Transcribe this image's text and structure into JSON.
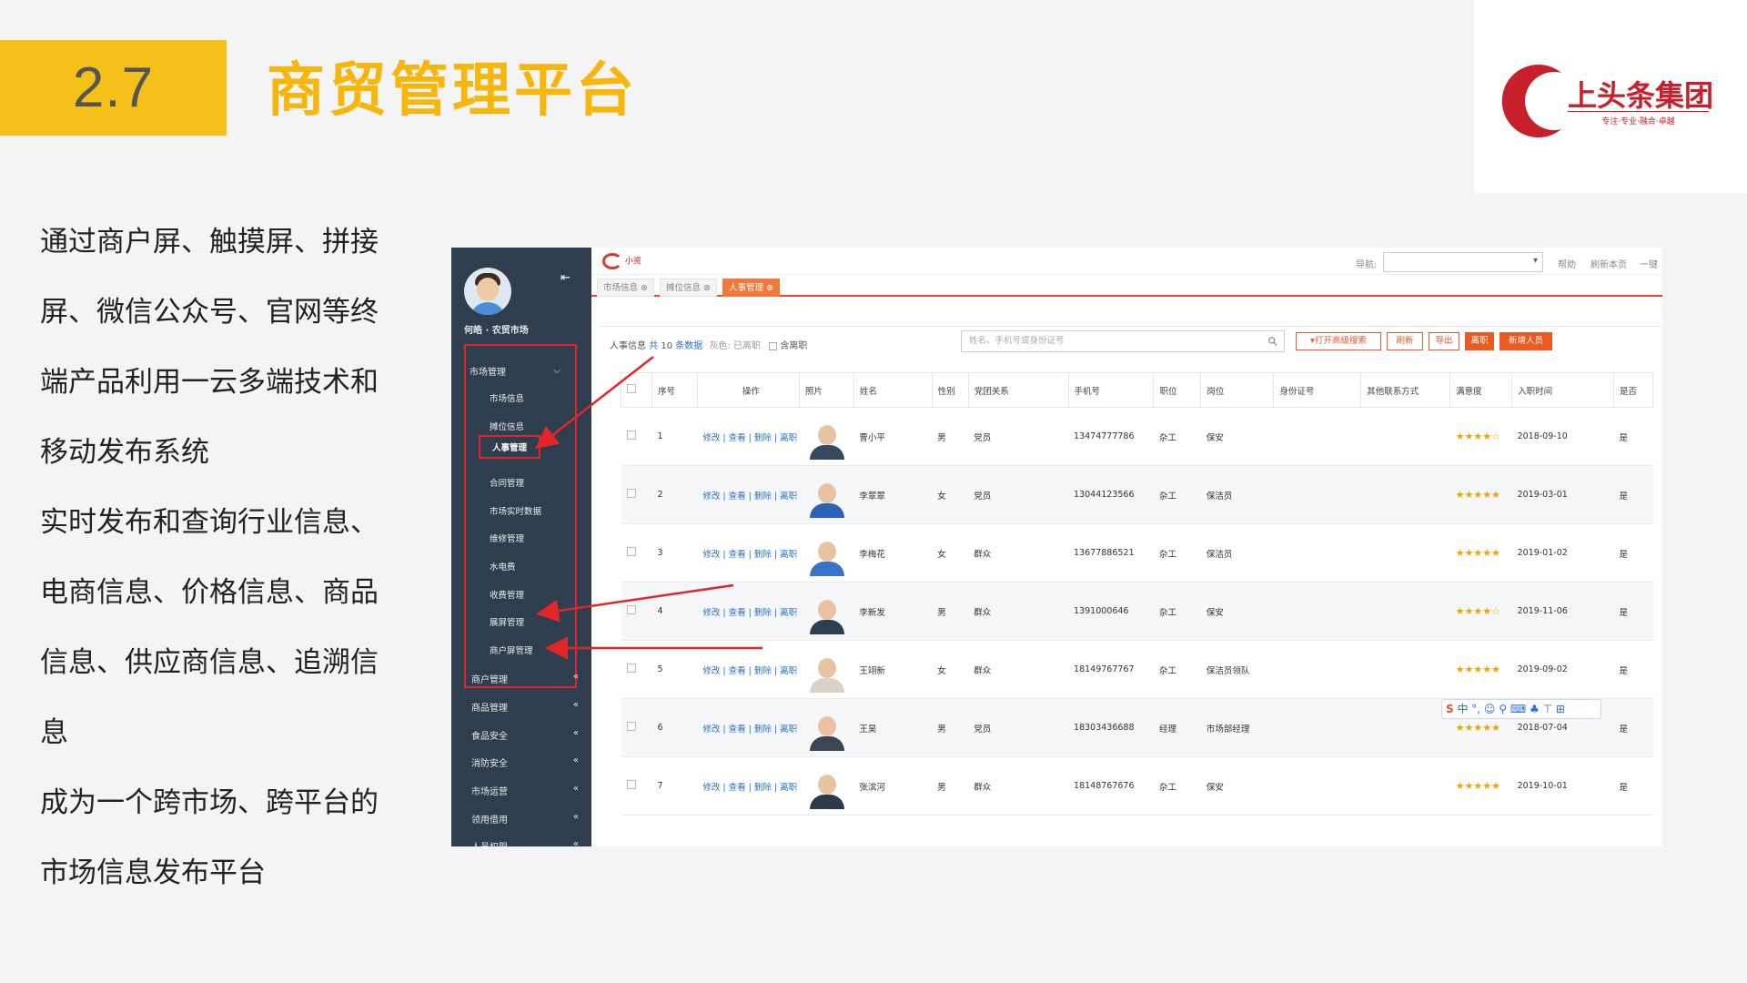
{
  "slide": {
    "number": "2.7",
    "title": "商贸管理平台",
    "logo_text": "上头条集团",
    "logo_slogan": "专注·专业·融合·卓越",
    "desc": [
      "通过商户屏、触摸屏、拼接",
      "屏、微信公众号、官网等终",
      "端产品利用一云多端技术和",
      "移动发布系统",
      "实时发布和查询行业信息、",
      "电商信息、价格信息、商品",
      "信息、供应商信息、追溯信",
      "息",
      "成为一个跨市场、跨平台的",
      "市场信息发布平台"
    ]
  },
  "colors": {
    "accent": "#f5c018",
    "title": "#f6b60c",
    "sidebar": "#2f3e4e",
    "highlight": "#e0262a",
    "orange": "#ee5a1e",
    "link": "#2b70c8",
    "star": "#f2a200"
  },
  "app": {
    "brand": "小资",
    "user_name": "何皓 · 农贸市场",
    "collapse_icon": "⇤",
    "menu_group": "市场管理",
    "submenu": [
      "市场信息",
      "摊位信息",
      "人事管理",
      "合同管理",
      "市场实时数据",
      "维修管理",
      "水电费",
      "收费管理",
      "展屏管理",
      "商户屏管理"
    ],
    "sections": [
      "商户管理",
      "商品管理",
      "食品安全",
      "消防安全",
      "市场运营",
      "领用借用",
      "人员权限"
    ],
    "nav_label": "导航:",
    "top_links": [
      "帮助",
      "刷新本页",
      "一键"
    ],
    "tabs": [
      {
        "label": "市场信息 ⊗"
      },
      {
        "label": "摊位信息 ⊗"
      },
      {
        "label": "人事管理 ⊗"
      }
    ],
    "toolbar": {
      "section": "人事信息",
      "count_prefix": "共",
      "count": "10",
      "count_suffix": "条数据",
      "legend": "灰色: 已离职",
      "include_resigned": "含离职",
      "search_placeholder": "姓名、手机号或身份证号",
      "buttons": [
        "▾打开高级搜索",
        "刷新",
        "导出",
        "离职",
        "新增人员"
      ]
    },
    "columns": [
      "序号",
      "操作",
      "照片",
      "姓名",
      "性别",
      "党团关系",
      "手机号",
      "职位",
      "岗位",
      "身份证号",
      "其他联系方式",
      "满意度",
      "入职时间",
      "是否"
    ],
    "actions": "修改 | 查看 | 删除 | 离职",
    "rows": [
      {
        "no": "1",
        "name": "曹小平",
        "gender": "男",
        "party": "党员",
        "phone": "13474777786",
        "title": "杂工",
        "post": "保安",
        "stars": "★★★★☆",
        "date": "2018-09-10",
        "flag": "是",
        "color": "#34495e"
      },
      {
        "no": "2",
        "name": "李翠翠",
        "gender": "女",
        "party": "党员",
        "phone": "13044123566",
        "title": "杂工",
        "post": "保洁员",
        "stars": "★★★★★",
        "date": "2019-03-01",
        "flag": "是",
        "color": "#2a63b8"
      },
      {
        "no": "3",
        "name": "李梅花",
        "gender": "女",
        "party": "群众",
        "phone": "13677886521",
        "title": "杂工",
        "post": "保洁员",
        "stars": "★★★★★",
        "date": "2019-01-02",
        "flag": "是",
        "color": "#3a74c8"
      },
      {
        "no": "4",
        "name": "李新发",
        "gender": "男",
        "party": "群众",
        "phone": "1391000646",
        "title": "杂工",
        "post": "保安",
        "stars": "★★★★☆",
        "date": "2019-11-06",
        "flag": "是",
        "color": "#2c3e50"
      },
      {
        "no": "5",
        "name": "王翊新",
        "gender": "女",
        "party": "群众",
        "phone": "18149767767",
        "title": "杂工",
        "post": "保洁员领队",
        "stars": "★★★★★",
        "date": "2019-09-02",
        "flag": "是",
        "color": "#d8d2c8"
      },
      {
        "no": "6",
        "name": "王昊",
        "gender": "男",
        "party": "党员",
        "phone": "18303436688",
        "title": "经理",
        "post": "市场部经理",
        "stars": "★★★★★",
        "date": "2018-07-04",
        "flag": "是",
        "color": "#3b4652"
      },
      {
        "no": "7",
        "name": "张滨河",
        "gender": "男",
        "party": "群众",
        "phone": "18148767676",
        "title": "杂工",
        "post": "保安",
        "stars": "★★★★★",
        "date": "2019-10-01",
        "flag": "是",
        "color": "#2c3a4a"
      }
    ],
    "ime": {
      "logo": "S",
      "items": "中 °, ☺ ⚲ ⌨ ♣ ⊤ ⊞"
    }
  }
}
